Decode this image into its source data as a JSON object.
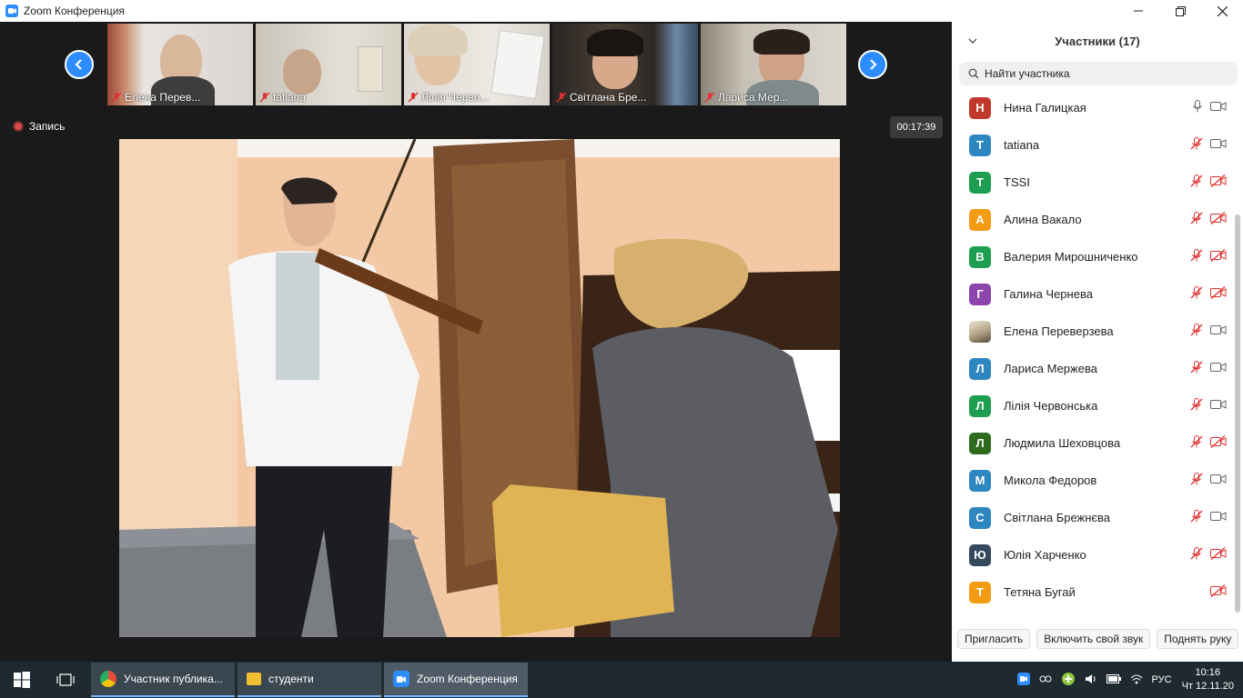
{
  "window": {
    "title": "Zoom Конференция"
  },
  "gallery": [
    {
      "name": "Елена Перев..."
    },
    {
      "name": "tatiana"
    },
    {
      "name": "Лілія Червo..."
    },
    {
      "name": "Світлана Бре..."
    },
    {
      "name": "Лариса Мер..."
    }
  ],
  "recording": {
    "label": "Запись"
  },
  "timer": "00:17:39",
  "panel": {
    "title": "Участники (17)",
    "search_placeholder": "Найти участника",
    "participants": [
      {
        "initial": "Н",
        "name": "Нина Галицкая",
        "color": "#c0392b",
        "mic": "on",
        "video": "on"
      },
      {
        "initial": "T",
        "name": "tatiana",
        "color": "#2e86c1",
        "mic": "muted",
        "video": "on"
      },
      {
        "initial": "T",
        "name": "TSSI",
        "color": "#1e9e50",
        "mic": "muted",
        "video": "off"
      },
      {
        "initial": "А",
        "name": "Алина Вакало",
        "color": "#f39c12",
        "mic": "muted",
        "video": "off"
      },
      {
        "initial": "В",
        "name": "Валерия Мирошниченко",
        "color": "#1e9e50",
        "mic": "muted",
        "video": "off"
      },
      {
        "initial": "Г",
        "name": "Галина Чернева",
        "color": "#8e44ad",
        "mic": "muted",
        "video": "off"
      },
      {
        "initial": "",
        "name": "Елена Переверзева",
        "color": "photo",
        "mic": "muted",
        "video": "on"
      },
      {
        "initial": "Л",
        "name": "Лариса Мержева",
        "color": "#2e86c1",
        "mic": "muted",
        "video": "on"
      },
      {
        "initial": "Л",
        "name": "Лілія Червонська",
        "color": "#1e9e50",
        "mic": "muted",
        "video": "on"
      },
      {
        "initial": "Л",
        "name": "Людмила Шеховцова",
        "color": "#2e6b1e",
        "mic": "muted",
        "video": "off"
      },
      {
        "initial": "М",
        "name": "Микола Федоров",
        "color": "#2e86c1",
        "mic": "muted",
        "video": "on"
      },
      {
        "initial": "С",
        "name": "Світлана Брежнєва",
        "color": "#2e86c1",
        "mic": "muted",
        "video": "on"
      },
      {
        "initial": "Ю",
        "name": "Юлія Харченко",
        "color": "#34495e",
        "mic": "muted",
        "video": "off"
      },
      {
        "initial": "Т",
        "name": "Тетяна Бугай",
        "color": "#f39c12",
        "mic": "none",
        "video": "off"
      }
    ],
    "buttons": {
      "invite": "Пригласить",
      "unmute": "Включить свой звук",
      "raise_hand": "Поднять руку"
    }
  },
  "taskbar": {
    "apps": [
      {
        "label": "Участник публика...",
        "icon": "chrome-icon"
      },
      {
        "label": "студенти",
        "icon": "folder-icon"
      },
      {
        "label": "Zoom Конференция",
        "icon": "zoom-icon"
      }
    ],
    "lang": "РУС",
    "time": "10:16",
    "date": "Чт 12.11.20"
  }
}
